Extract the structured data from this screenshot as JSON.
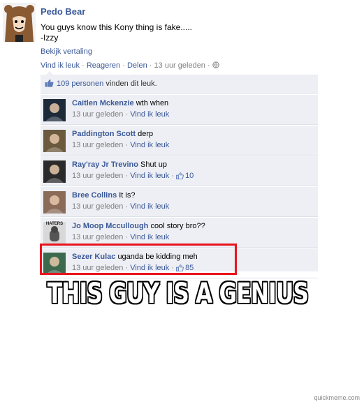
{
  "post": {
    "author": "Pedo Bear",
    "text_line1": "You guys know this Kony thing is fake.....",
    "text_line2": "-Izzy",
    "translate_label": "Bekijk vertaling",
    "actions": {
      "like": "Vind ik leuk",
      "comment": "Reageren",
      "share": "Delen",
      "time": "13 uur geleden",
      "sep": "·"
    }
  },
  "likes": {
    "count_label": "109 personen",
    "suffix": "vinden dit leuk."
  },
  "comments": [
    {
      "name": "Caitlen Mckenzie",
      "text": "wth when",
      "time": "13 uur geleden",
      "like": "Vind ik leuk",
      "like_count": "",
      "avatar_color": "#1c2a3a"
    },
    {
      "name": "Paddington Scott",
      "text": "derp",
      "time": "13 uur geleden",
      "like": "Vind ik leuk",
      "like_count": "",
      "avatar_color": "#6b5a3e"
    },
    {
      "name": "Ray'ray Jr Trevino",
      "text": "Shut up",
      "time": "13 uur geleden",
      "like": "Vind ik leuk",
      "like_count": "10",
      "avatar_color": "#2a2a2a"
    },
    {
      "name": "Bree Collins",
      "text": "It is?",
      "time": "13 uur geleden",
      "like": "Vind ik leuk",
      "like_count": "",
      "avatar_color": "#8a6b58"
    },
    {
      "name": "Jo Moop Mccullough",
      "text": "cool story bro??",
      "time": "13 uur geleden",
      "like": "Vind ik leuk",
      "like_count": "",
      "avatar_color": "#9a9a9a",
      "avatar_text": "HATERS"
    },
    {
      "name": "Sezer Kulac",
      "text": "uganda be kidding meh",
      "time": "13 uur geleden",
      "like": "Vind ik leuk",
      "like_count": "85",
      "avatar_color": "#3d6a4e"
    }
  ],
  "meme_caption": "THIS GUY IS A GENIUS",
  "watermark": "quickmeme.com",
  "colors": {
    "link": "#3b5998",
    "comment_bg": "#edeff4",
    "highlight_box": "#e8131d"
  }
}
